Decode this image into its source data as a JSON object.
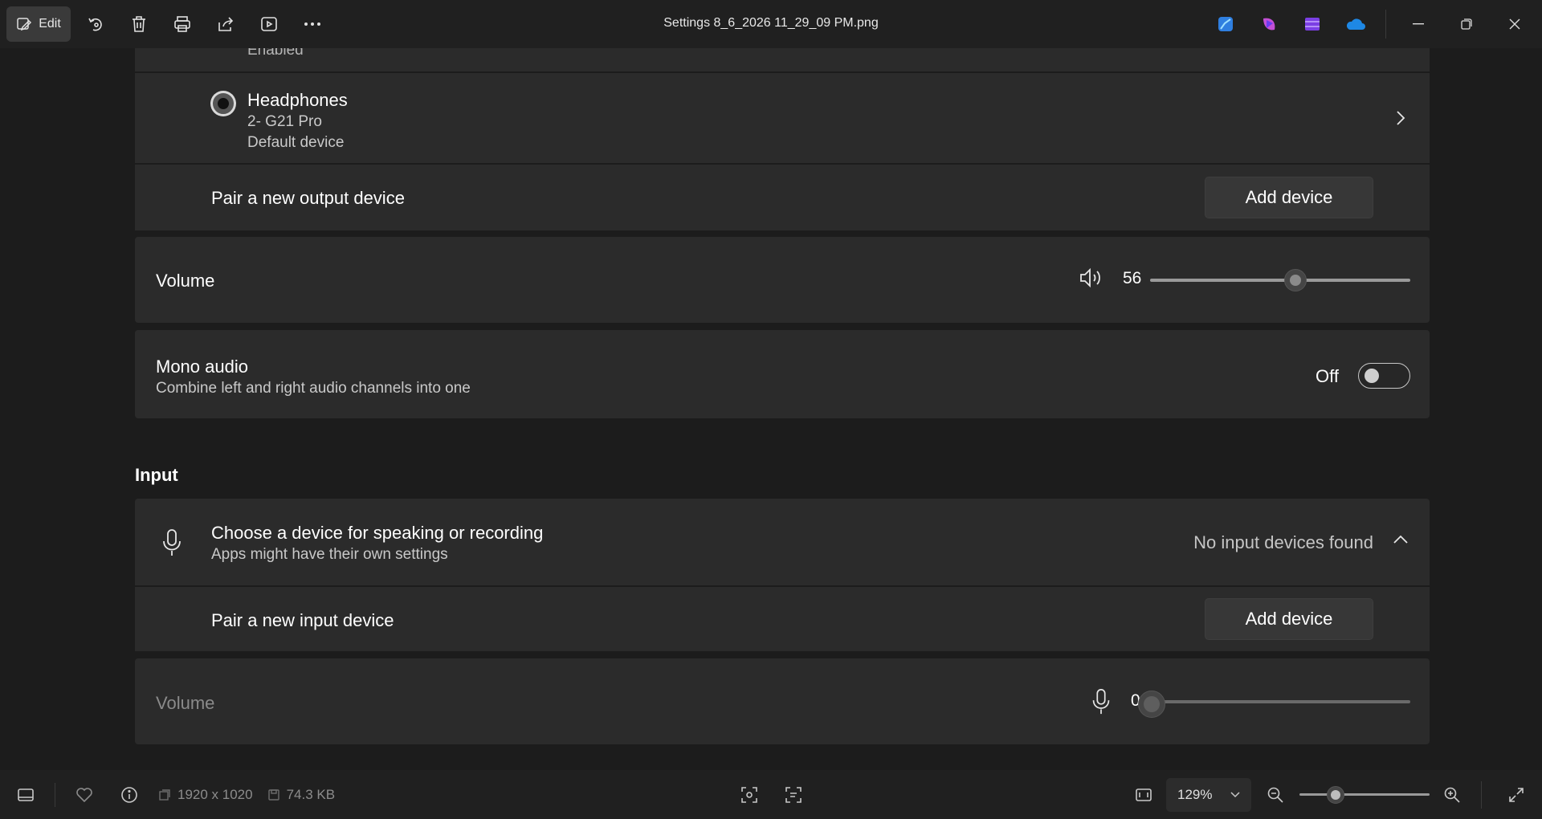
{
  "titlebar": {
    "edit_label": "Edit",
    "filename": "Settings 8_6_2026 11_29_09 PM.png",
    "toolbar_icons": [
      "rotate-icon",
      "delete-icon",
      "print-icon",
      "share-icon",
      "slideshow-icon",
      "more-icon"
    ],
    "app_icons": [
      "photos-icon",
      "clipchamp-icon",
      "video-editor-icon",
      "onedrive-icon"
    ]
  },
  "output": {
    "top_row_status": "Enabled",
    "headphones": {
      "name": "Headphones",
      "model": "2- G21 Pro",
      "status": "Default device"
    },
    "pair_label": "Pair a new output device",
    "add_device_label": "Add device",
    "volume": {
      "label": "Volume",
      "value": "56",
      "level": 56
    },
    "mono": {
      "title": "Mono audio",
      "description": "Combine left and right audio channels into one",
      "state_label": "Off"
    }
  },
  "input": {
    "heading": "Input",
    "choose": {
      "title": "Choose a device for speaking or recording",
      "subtitle": "Apps might have their own settings",
      "status": "No input devices found"
    },
    "pair_label": "Pair a new input device",
    "add_device_label": "Add device",
    "volume": {
      "label": "Volume",
      "value": "0",
      "level": 0
    }
  },
  "statusbar": {
    "dimensions": "1920 x 1020",
    "file_size": "74.3 KB",
    "zoom": "129%",
    "zoom_level": 0.28
  },
  "colors": {
    "accent_onedrive": "#1e88e5",
    "card": "#2b2b2b",
    "background": "#1c1c1c"
  }
}
